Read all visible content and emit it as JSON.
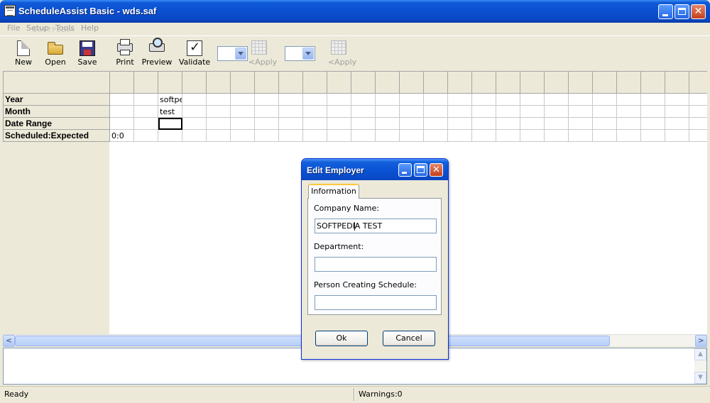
{
  "window": {
    "title": "ScheduleAssist Basic - wds.saf",
    "controls": [
      "minimize",
      "maximize",
      "close"
    ]
  },
  "menu": {
    "items": [
      "File",
      "Setup",
      "Tools",
      "Help"
    ],
    "watermark": "SOFTPEDIA"
  },
  "toolbar": {
    "new_label": "New",
    "open_label": "Open",
    "save_label": "Save",
    "print_label": "Print",
    "preview_label": "Preview",
    "validate_label": "Validate",
    "apply1_label": "<Apply",
    "apply2_label": "<Apply",
    "combo1_value": "",
    "combo2_value": ""
  },
  "grid": {
    "rows": [
      {
        "label": "Year",
        "cells": [
          "",
          "",
          "softpedia"
        ]
      },
      {
        "label": "Month",
        "cells": [
          "",
          "",
          "test"
        ]
      },
      {
        "label": "Date Range",
        "cells": [
          "",
          "",
          ""
        ]
      },
      {
        "label": "Scheduled:Expected",
        "cells": [
          "0:0",
          "",
          ""
        ]
      }
    ]
  },
  "statusbar": {
    "left": "Ready",
    "right": "Warnings:0"
  },
  "dialog": {
    "title": "Edit Employer",
    "tab": "Information",
    "company_label": "Company Name:",
    "company_value": "SOFTPEDIA TEST",
    "department_label": "Department:",
    "department_value": "",
    "person_label": "Person Creating Schedule:",
    "person_value": "",
    "ok_label": "Ok",
    "cancel_label": "Cancel"
  }
}
